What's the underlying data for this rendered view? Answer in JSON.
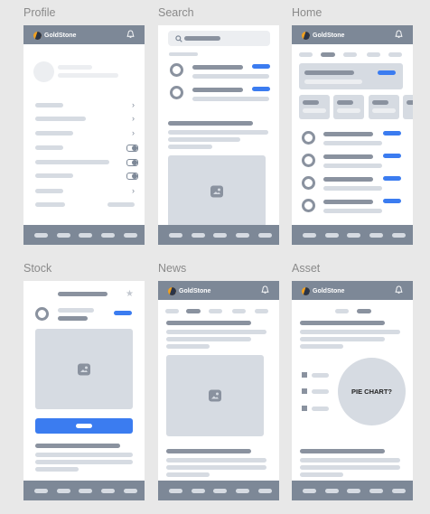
{
  "screens": [
    {
      "title": "Profile"
    },
    {
      "title": "Search"
    },
    {
      "title": "Home"
    },
    {
      "title": "Stock"
    },
    {
      "title": "News"
    },
    {
      "title": "Asset"
    }
  ],
  "brand": "GoldStone",
  "asset": {
    "pie_label": "PIE CHART?"
  },
  "colors": {
    "header": "#7d8897",
    "accent": "#3b7cf0",
    "logo": "#f0a020",
    "placeholder": "#d6dbe2"
  },
  "icons": {
    "bell": "bell-icon",
    "image": "image-placeholder-icon",
    "chevron": "chevron-right-icon",
    "star": "star-icon",
    "search": "search-icon"
  }
}
